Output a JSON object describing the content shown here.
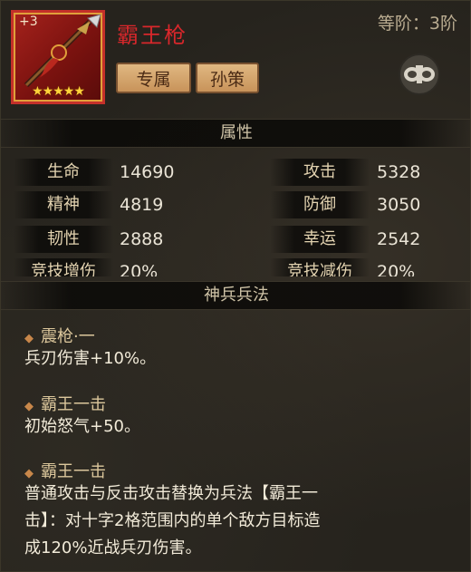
{
  "item": {
    "level_badge": "+3",
    "stars": "★★★★★",
    "name": "霸王枪",
    "rank": "等阶：3阶",
    "tags": [
      "专属",
      "孙策"
    ]
  },
  "sections": {
    "attributes": "属性",
    "skills": "神兵兵法"
  },
  "attributes": [
    {
      "label": "生命",
      "value": "14690"
    },
    {
      "label": "攻击",
      "value": "5328"
    },
    {
      "label": "精神",
      "value": "4819"
    },
    {
      "label": "防御",
      "value": "3050"
    },
    {
      "label": "韧性",
      "value": "2888"
    },
    {
      "label": "幸运",
      "value": "2542"
    },
    {
      "label": "竞技增伤",
      "value": "20%"
    },
    {
      "label": "竞技减伤",
      "value": "20%"
    }
  ],
  "skills": [
    {
      "title": "震枪·一",
      "desc": [
        "兵刃伤害+10%。"
      ]
    },
    {
      "title": "霸王一击",
      "desc": [
        "初始怒气+50。"
      ]
    },
    {
      "title": "霸王一击",
      "desc": [
        "普通攻击与反击攻击替换为兵法【霸王一",
        "击】：对十字2格范围内的单个敌方目标造",
        "成120%近战兵刃伤害。"
      ]
    }
  ],
  "colors": {
    "name": "#d9272b",
    "frame": "#c4302a",
    "star": "#ffd23a"
  },
  "icons": {
    "circle_button": "handcuff-icon",
    "skill_bullet": "diamond-icon"
  }
}
